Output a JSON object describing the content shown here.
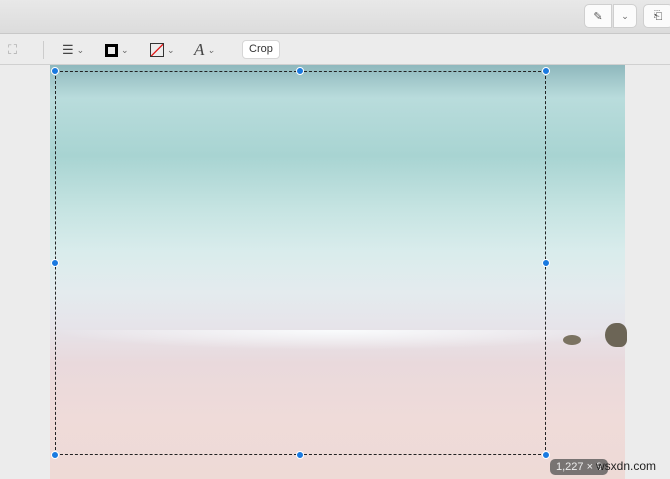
{
  "toolbar": {
    "crop_label": "Crop"
  },
  "selection": {
    "dimensions": "1,227 × 9"
  },
  "watermark": "wsxdn.com",
  "colors": {
    "handle": "#1a7ae0"
  }
}
